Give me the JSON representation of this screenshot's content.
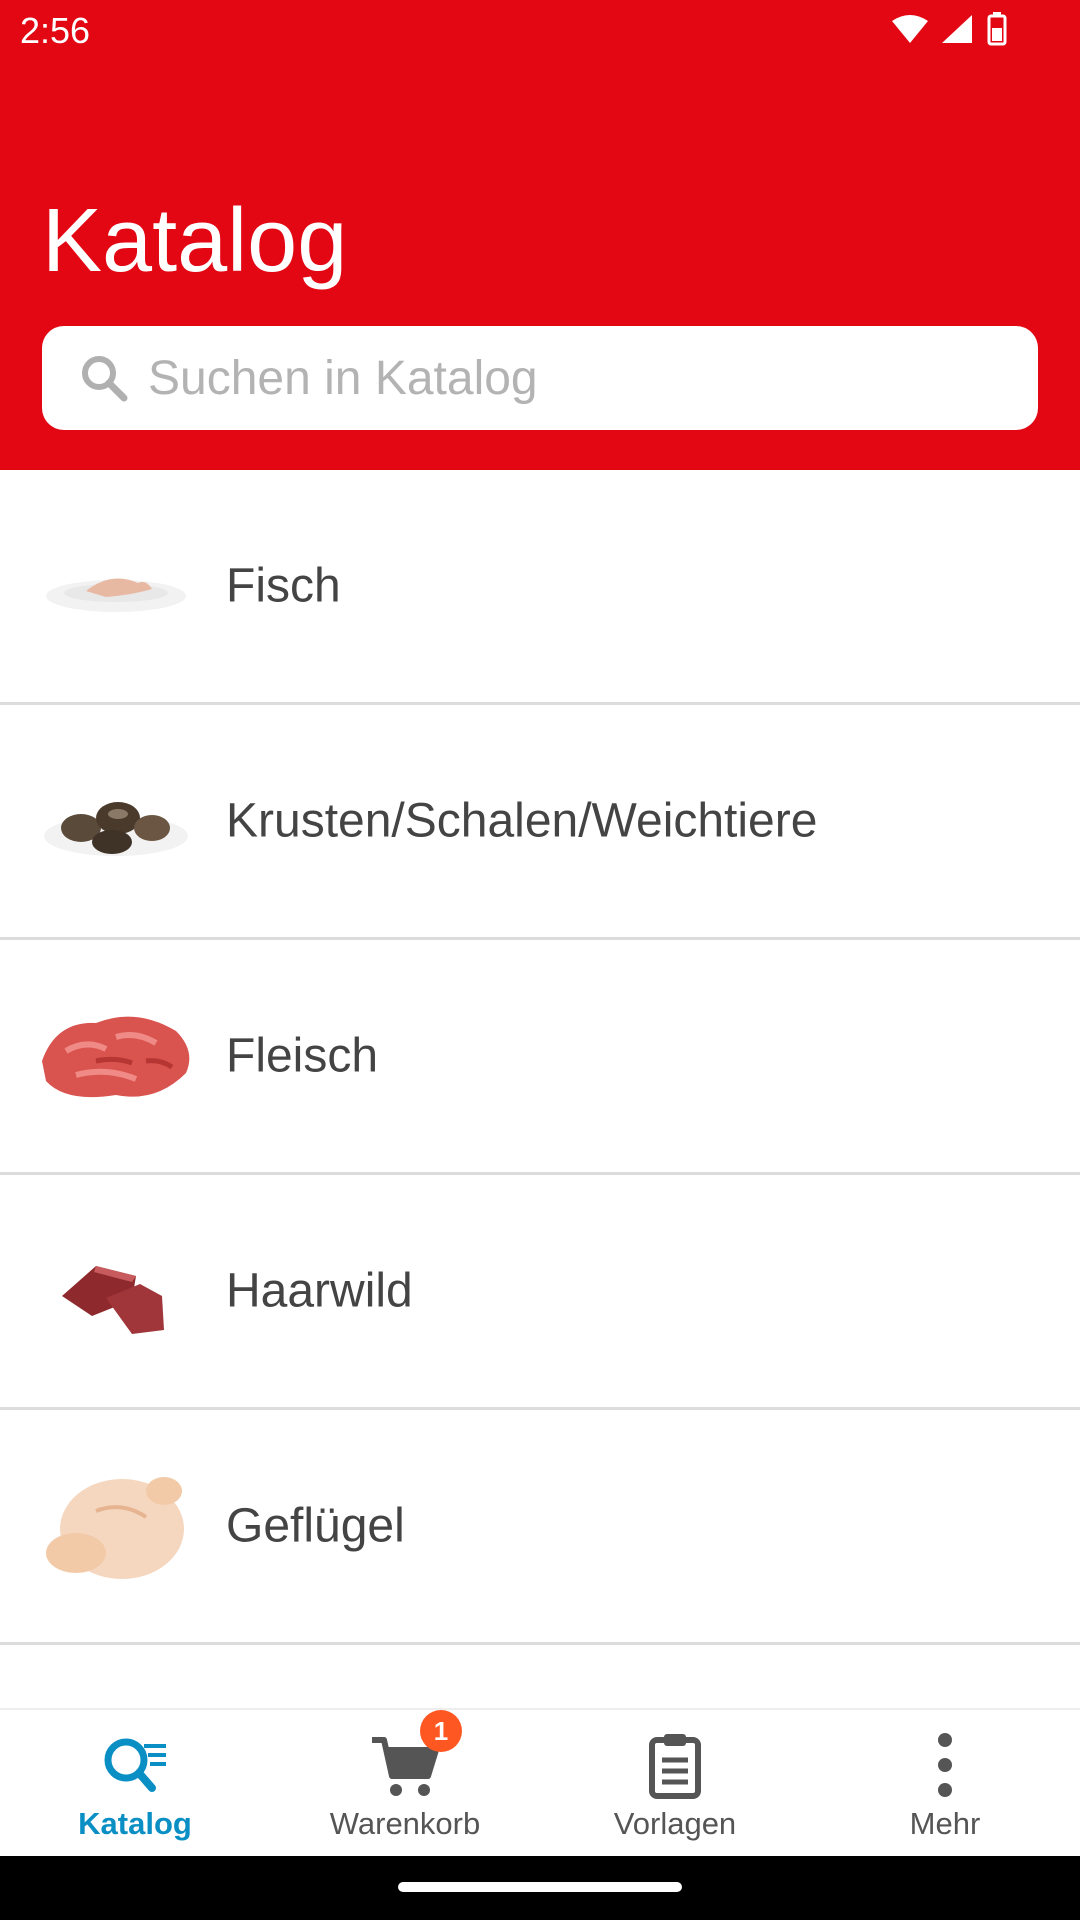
{
  "status_bar": {
    "time": "2:56"
  },
  "header": {
    "title": "Katalog",
    "search_placeholder": "Suchen in Katalog",
    "search_value": ""
  },
  "categories": [
    {
      "label": "Fisch",
      "icon": "fish-thumbnail"
    },
    {
      "label": "Krusten/Schalen/Weichtiere",
      "icon": "shellfish-thumbnail"
    },
    {
      "label": "Fleisch",
      "icon": "meat-thumbnail"
    },
    {
      "label": "Haarwild",
      "icon": "game-meat-thumbnail"
    },
    {
      "label": "Geflügel",
      "icon": "poultry-thumbnail"
    }
  ],
  "bottom_nav": {
    "items": [
      {
        "label": "Katalog",
        "icon": "catalog-search-icon",
        "active": true
      },
      {
        "label": "Warenkorb",
        "icon": "cart-icon",
        "active": false
      },
      {
        "label": "Vorlagen",
        "icon": "clipboard-icon",
        "active": false
      },
      {
        "label": "Mehr",
        "icon": "more-vertical-icon",
        "active": false
      }
    ],
    "cart_badge": "1"
  },
  "colors": {
    "brand_red": "#e30613",
    "active_blue": "#0a8fc4",
    "badge_orange": "#ff5722"
  }
}
